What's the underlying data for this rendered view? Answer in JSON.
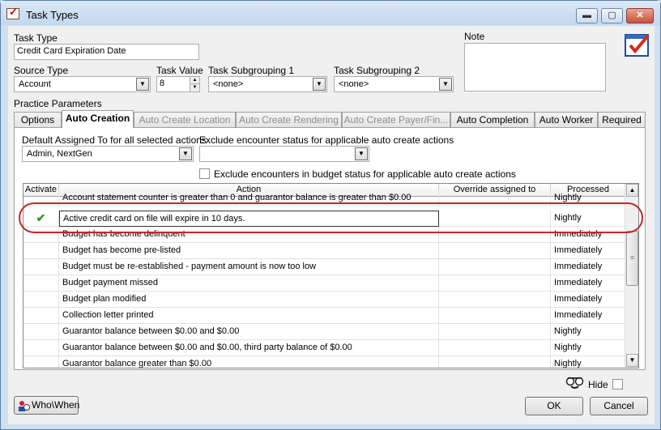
{
  "window": {
    "title": "Task Types",
    "minimize": "▬",
    "maximize": "▢",
    "close": "✕"
  },
  "form": {
    "task_type_label": "Task Type",
    "task_type_value": "Credit Card Expiration Date",
    "source_type_label": "Source Type",
    "source_type_value": "Account",
    "task_value_label": "Task Value",
    "task_value_value": "8",
    "subgroup1_label": "Task Subgrouping 1",
    "subgroup1_value": "<none>",
    "subgroup2_label": "Task Subgrouping 2",
    "subgroup2_value": "<none>",
    "note_label": "Note",
    "note_value": "",
    "practice_params_label": "Practice Parameters"
  },
  "tabs": [
    {
      "label": "Options",
      "state": "normal"
    },
    {
      "label": "Auto Creation",
      "state": "active"
    },
    {
      "label": "Auto Create Location",
      "state": "disabled"
    },
    {
      "label": "Auto Create Rendering",
      "state": "disabled"
    },
    {
      "label": "Auto Create Payer/Fin...",
      "state": "disabled"
    },
    {
      "label": "Auto Completion",
      "state": "normal"
    },
    {
      "label": "Auto Worker",
      "state": "normal"
    },
    {
      "label": "Required",
      "state": "normal"
    }
  ],
  "auto_creation": {
    "default_assigned_label": "Default Assigned To for all selected actions",
    "default_assigned_value": "Admin, NextGen",
    "exclude_status_label": "Exclude encounter status for applicable auto create actions",
    "exclude_status_value": "",
    "exclude_budget_label": "Exclude encounters in budget status for applicable auto create actions"
  },
  "grid": {
    "columns": [
      "Activate",
      "Action",
      "Override assigned to",
      "Processed"
    ],
    "rows": [
      {
        "activate": "",
        "action": "Account statement counter is greater than 0 and guarantor balance is greater than $0.00",
        "override": "",
        "processed": "Nightly"
      },
      {
        "activate": "✔",
        "action": "Active credit card on file will expire in 10 days.",
        "override": "",
        "processed": "Nightly"
      },
      {
        "activate": "",
        "action": "Budget has become delinquent",
        "override": "",
        "processed": "Immediately"
      },
      {
        "activate": "",
        "action": "Budget has become pre-listed",
        "override": "",
        "processed": "Immediately"
      },
      {
        "activate": "",
        "action": "Budget must be re-established - payment amount is now too low",
        "override": "",
        "processed": "Immediately"
      },
      {
        "activate": "",
        "action": "Budget payment missed",
        "override": "",
        "processed": "Immediately"
      },
      {
        "activate": "",
        "action": "Budget plan modified",
        "override": "",
        "processed": "Immediately"
      },
      {
        "activate": "",
        "action": "Collection letter printed",
        "override": "",
        "processed": "Immediately"
      },
      {
        "activate": "",
        "action": "Guarantor balance between $0.00 and $0.00",
        "override": "",
        "processed": "Nightly"
      },
      {
        "activate": "",
        "action": "Guarantor balance between $0.00 and $0.00, third party balance of $0.00",
        "override": "",
        "processed": "Nightly"
      },
      {
        "activate": "",
        "action": "Guarantor balance greater than $0.00",
        "override": "",
        "processed": "Nightly"
      }
    ]
  },
  "footer": {
    "hide_label": "Hide",
    "who_when_label": "Who\\When",
    "ok_label": "OK",
    "cancel_label": "Cancel"
  },
  "colors": {
    "check_green": "#2e9a1e",
    "highlight_red": "#c0282a",
    "window_frame": "#cfe0f1"
  },
  "icons": [
    "task-types-icon",
    "dropdown-arrow-icon",
    "spin-up-icon",
    "spin-down-icon",
    "checkmark-icon",
    "notepad-check-icon",
    "disguise-glasses-icon",
    "who-when-icon"
  ]
}
